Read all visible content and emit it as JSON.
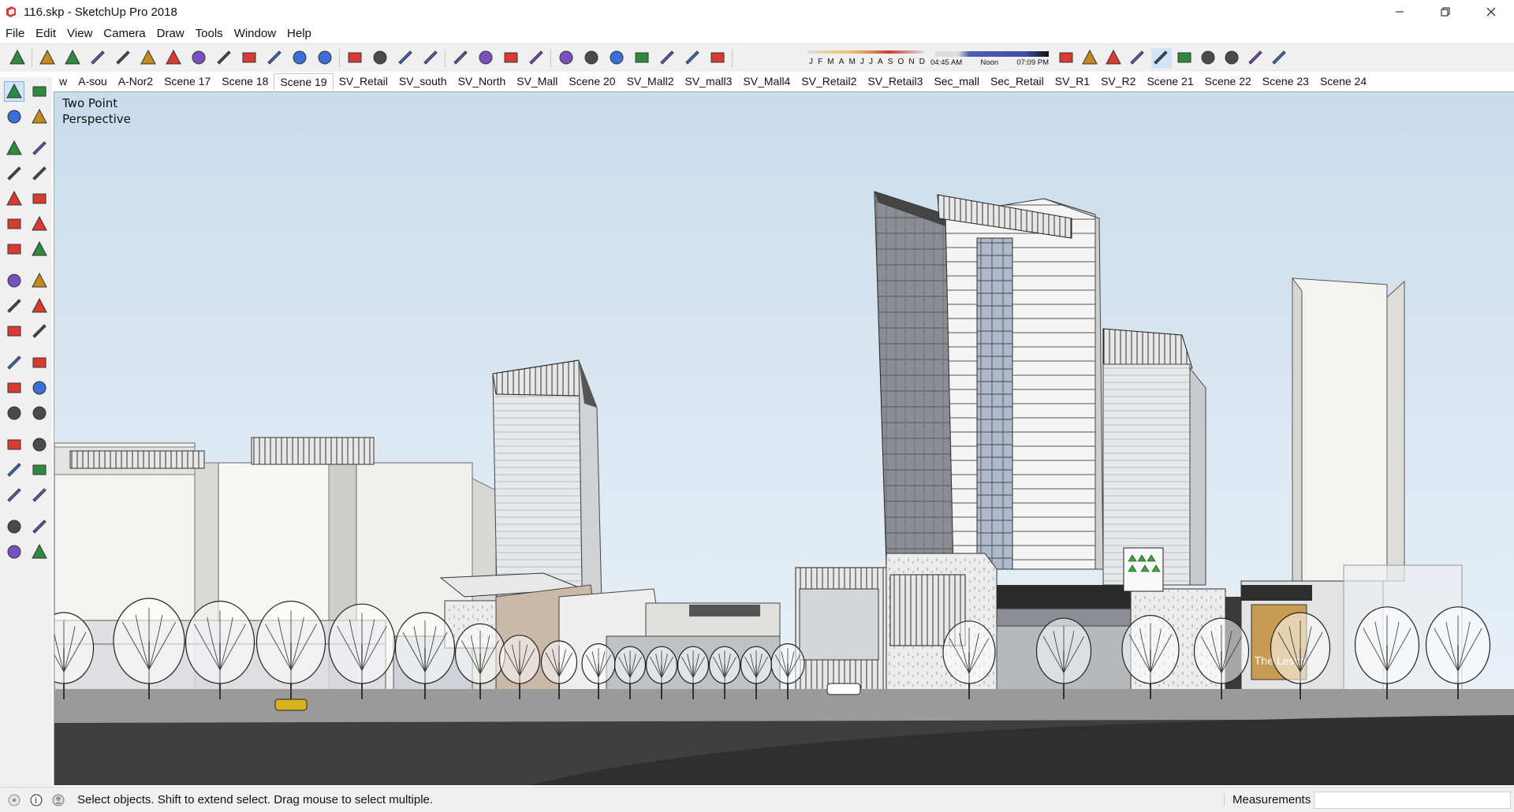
{
  "window": {
    "title": "116.skp - SketchUp Pro 2018",
    "controls": [
      "minimize",
      "restore",
      "close"
    ]
  },
  "menu": [
    "File",
    "Edit",
    "View",
    "Camera",
    "Draw",
    "Tools",
    "Window",
    "Help"
  ],
  "toolbar": {
    "tools": [
      "select-icon",
      "eraser-icon",
      "pencil-line-icon",
      "freehand-icon",
      "rectangle-icon",
      "push-pull-icon",
      "follow-me-icon",
      "move-icon",
      "rotate-icon",
      "scale-icon",
      "tape-measure-icon",
      "text-icon",
      "paint-bucket-icon",
      "orbit-icon",
      "pan-icon",
      "zoom-icon",
      "zoom-extents-icon",
      "3d-warehouse-icon",
      "extension-warehouse-icon",
      "layout-icon",
      "extension-manager-icon",
      "iso-view-icon",
      "top-view-icon",
      "front-view-icon",
      "right-view-icon",
      "back-view-icon",
      "left-view-icon",
      "shadows-toggle-icon"
    ],
    "shadow_months": [
      "J",
      "F",
      "M",
      "A",
      "M",
      "J",
      "J",
      "A",
      "S",
      "O",
      "N",
      "D"
    ],
    "shadow_times": [
      "04:45 AM",
      "Noon",
      "07:09 PM"
    ],
    "style_tools": [
      "xray-icon",
      "back-edges-icon",
      "wireframe-icon",
      "hidden-line-icon",
      "shaded-icon",
      "shaded-textures-icon",
      "monochrome-icon",
      "geo-location-icon",
      "sandbox-icon",
      "stamp-icon"
    ]
  },
  "scenes": {
    "tabs": [
      "w",
      "A-sou",
      "A-Nor2",
      "Scene 17",
      "Scene 18",
      "Scene 19",
      "SV_Retail",
      "SV_south",
      "SV_North",
      "SV_Mall",
      "Scene 20",
      "SV_Mall2",
      "SV_mall3",
      "SV_Mall4",
      "SV_Retail2",
      "SV_Retail3",
      "Sec_mall",
      "Sec_Retail",
      "SV_R1",
      "SV_R2",
      "Scene 21",
      "Scene 22",
      "Scene 23",
      "Scene 24"
    ],
    "active": "Scene 19"
  },
  "left_tools": [
    "select-icon",
    "make-component-icon",
    "paint-bucket-icon",
    "eraser-icon",
    "line-icon",
    "freehand-icon",
    "rectangle-icon",
    "rotated-rectangle-icon",
    "circle-icon",
    "polygon-icon",
    "arc-icon",
    "two-point-arc-icon",
    "three-point-arc-icon",
    "pie-icon",
    "move-icon",
    "push-pull-icon",
    "rotate-icon",
    "follow-me-icon",
    "scale-icon",
    "offset-icon",
    "tape-measure-icon",
    "dimension-icon",
    "protractor-icon",
    "text-icon",
    "axes-icon",
    "3d-text-icon",
    "orbit-icon",
    "pan-icon",
    "zoom-icon",
    "zoom-window-icon",
    "zoom-extents-icon",
    "previous-view-icon",
    "position-camera-icon",
    "look-around-icon",
    "walk-icon",
    "section-plane-icon"
  ],
  "viewport": {
    "camera_label_line1": "Two Point",
    "camera_label_line2": "Perspective",
    "sky_top": "#c9dcec",
    "sky_bottom": "#eef3f8",
    "ground": "#3f3f3f",
    "storefront_sign": "The Lesco"
  },
  "status": {
    "message": "Select objects. Shift to extend select. Drag mouse to select multiple.",
    "measurements_label": "Measurements",
    "measurements_value": ""
  },
  "colors": {
    "chrome": "#f0f0f0",
    "accent_red": "#d93a32",
    "selection_blue": "#cfe4f7"
  }
}
